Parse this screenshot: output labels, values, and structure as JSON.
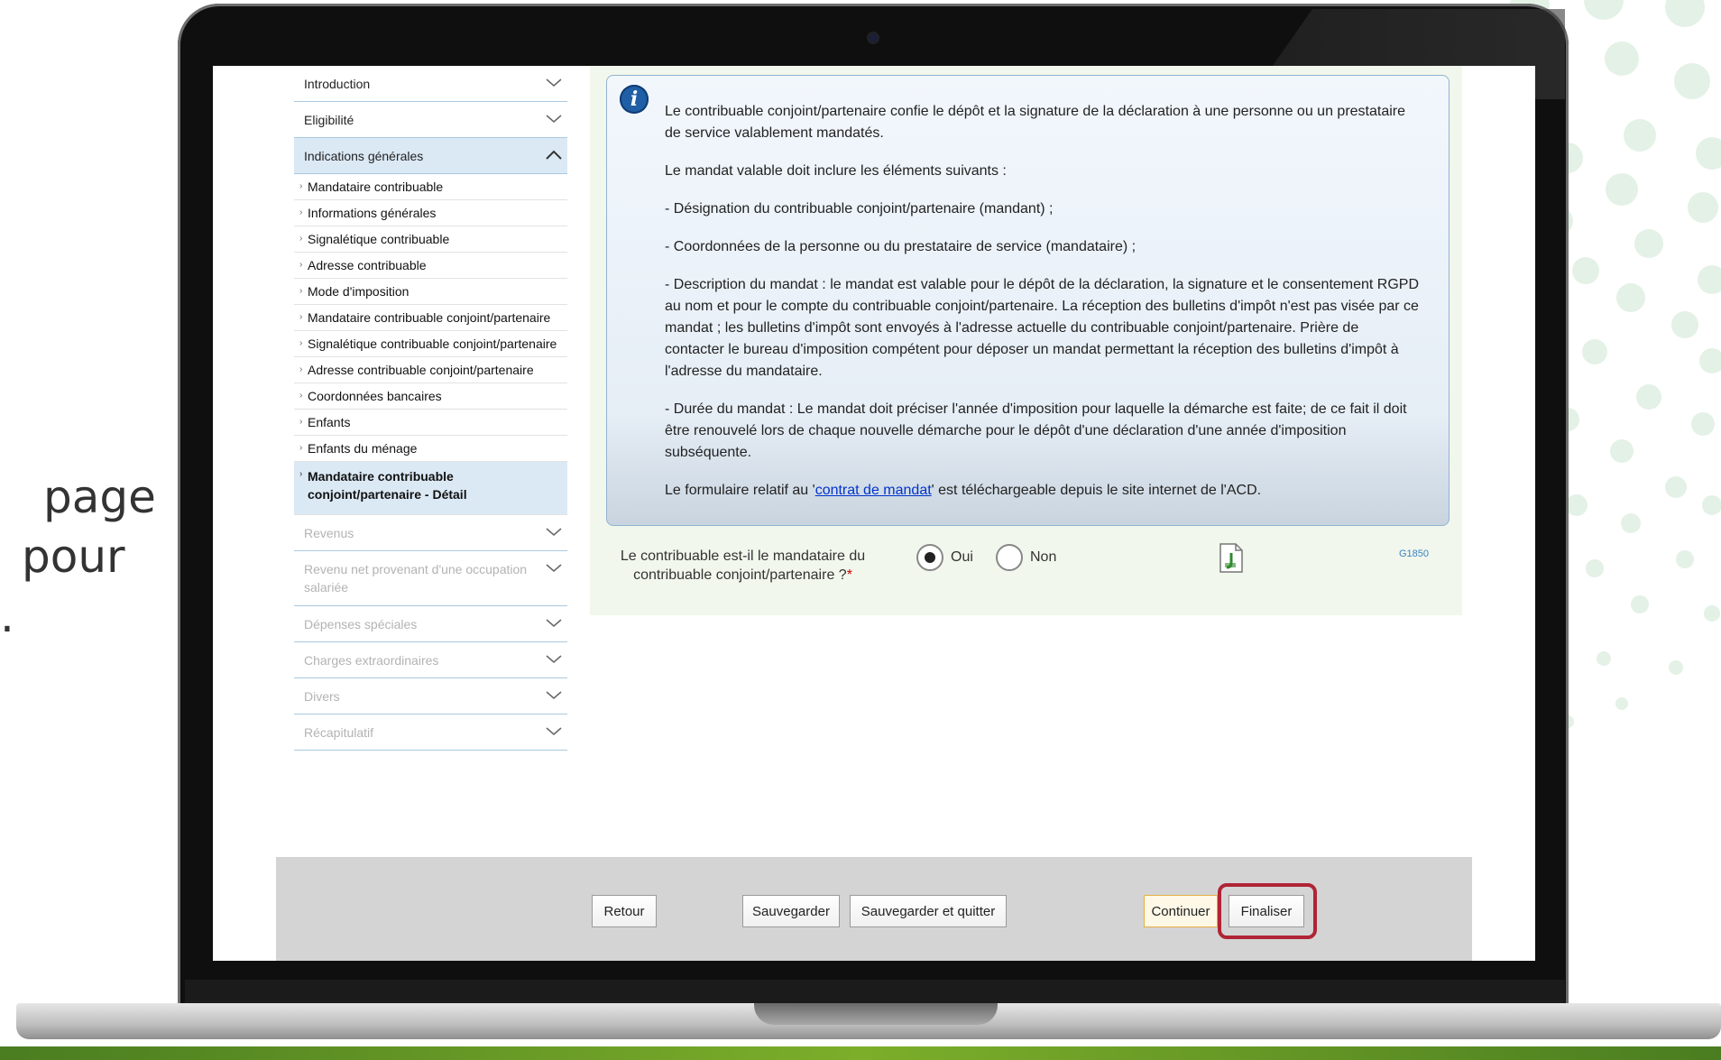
{
  "side_text": {
    "line1": "page",
    "line2": "pour",
    "line3": "."
  },
  "sidebar": {
    "sections_top": [
      {
        "label": "Introduction",
        "icon": "chevron-down-icon"
      },
      {
        "label": "Eligibilité",
        "icon": "chevron-down-icon"
      },
      {
        "label": "Indications générales",
        "icon": "chevron-up-icon"
      }
    ],
    "items": [
      {
        "label": "Mandataire contribuable"
      },
      {
        "label": "Informations générales"
      },
      {
        "label": "Signalétique contribuable"
      },
      {
        "label": "Adresse contribuable"
      },
      {
        "label": "Mode d'imposition"
      },
      {
        "label": "Mandataire contribuable conjoint/partenaire"
      },
      {
        "label": "Signalétique contribuable conjoint/partenaire"
      },
      {
        "label": "Adresse contribuable conjoint/partenaire"
      },
      {
        "label": "Coordonnées bancaires"
      },
      {
        "label": "Enfants"
      },
      {
        "label": "Enfants du ménage"
      },
      {
        "label": "Mandataire contribuable conjoint/partenaire - Détail"
      }
    ],
    "sections_bottom": [
      {
        "label": "Revenus"
      },
      {
        "label": "Revenu net provenant d'une occupation salariée"
      },
      {
        "label": "Dépenses spéciales"
      },
      {
        "label": "Charges extraordinaires"
      },
      {
        "label": "Divers"
      },
      {
        "label": "Récapitulatif"
      }
    ]
  },
  "info": {
    "p1": "Le contribuable conjoint/partenaire confie le dépôt et la signature de la déclaration à une personne ou un prestataire de service valablement mandatés.",
    "p2": "Le mandat valable doit inclure les éléments suivants :",
    "p3": "- Désignation du contribuable conjoint/partenaire (mandant) ;",
    "p4": "- Coordonnées de la personne ou du prestataire de service (mandataire) ;",
    "p5": "- Description du mandat : le mandat est valable pour le dépôt de la déclaration, la signature et le consentement RGPD au nom et pour le compte du contribuable conjoint/partenaire. La réception des bulletins d'impôt n'est pas visée par ce mandat ; les bulletins d'impôt sont envoyés à l'adresse actuelle du contribuable conjoint/partenaire. Prière de contacter le bureau d'imposition compétent pour déposer un mandat permettant la réception des bulletins d'impôt à l'adresse du mandataire.",
    "p6": "- Durée du mandat : Le mandat doit préciser l'année d'imposition pour laquelle la démarche est faite; de ce fait il doit être renouvelé lors de chaque nouvelle démarche pour le dépôt d'une déclaration d'une année d'imposition subséquente.",
    "p7_before": "Le formulaire relatif au '",
    "p7_link": "contrat de mandat",
    "p7_after": "' est téléchargeable depuis le site internet de l'ACD."
  },
  "question": {
    "text": "Le contribuable est-il le mandataire du contribuable conjoint/partenaire ?",
    "required_marker": "*",
    "options": [
      {
        "label": "Oui",
        "selected": true
      },
      {
        "label": "Non",
        "selected": false
      }
    ],
    "code": "G1850"
  },
  "footer": {
    "retour": "Retour",
    "sauvegarder": "Sauvegarder",
    "sauvegarder_quitter": "Sauvegarder et quitter",
    "continuer": "Continuer",
    "finaliser": "Finaliser"
  },
  "colors": {
    "accent": "#dbe9f5",
    "highlight": "#b02436",
    "content_bg": "#f1f7ec",
    "link": "#0033cc"
  }
}
